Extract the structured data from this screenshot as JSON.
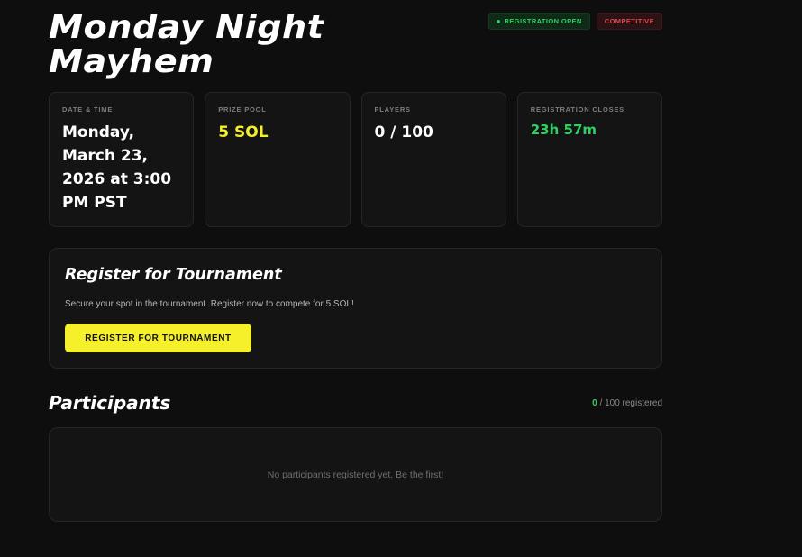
{
  "tournament": {
    "title": "Monday Night Mayhem"
  },
  "badges": {
    "registration": "REGISTRATION OPEN",
    "mode": "COMPETITIVE"
  },
  "stats": [
    {
      "label": "DATE & TIME",
      "value": "Monday, March 23, 2026 at 3:00 PM PST"
    },
    {
      "label": "PRIZE POOL",
      "value": "5 SOL"
    },
    {
      "label": "PLAYERS",
      "value": "0 / 100"
    },
    {
      "label": "REGISTRATION CLOSES",
      "value": "23h 57m"
    }
  ],
  "register": {
    "heading": "Register for Tournament",
    "description": "Secure your spot in the tournament. Register now to compete for 5 SOL!",
    "button_label": "REGISTER FOR TOURNAMENT"
  },
  "participants": {
    "heading": "Participants",
    "registered_count": "0",
    "registered_suffix": " / 100 registered",
    "empty_message": "No participants registered yet. Be the first!"
  },
  "colors": {
    "background": "#0e0e0e",
    "accent_yellow": "#f5f02a",
    "accent_green": "#2fcf63",
    "accent_red": "#e0474c"
  }
}
